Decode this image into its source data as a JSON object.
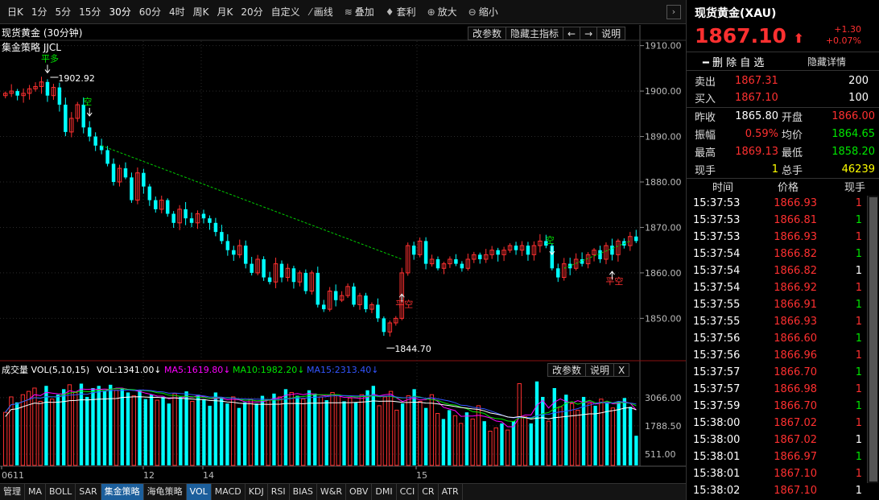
{
  "toolbar": {
    "periods": [
      "日K",
      "1分",
      "5分",
      "15分",
      "30分",
      "60分",
      "4时",
      "周K",
      "月K",
      "20分",
      "自定义"
    ],
    "active_period": "30分",
    "tools": [
      {
        "icon": "draw-line-icon",
        "label": "画线"
      },
      {
        "icon": "overlay-icon",
        "label": "叠加"
      },
      {
        "icon": "arbitrage-icon",
        "label": "套利"
      },
      {
        "icon": "zoom-in-icon",
        "label": "放大"
      },
      {
        "icon": "zoom-out-icon",
        "label": "缩小"
      }
    ],
    "collapse": "›"
  },
  "main": {
    "title": "现货黄金 (30分钟)",
    "strategy": "集金策略 JJCL",
    "buttons": [
      "改参数",
      "隐藏主指标",
      "←",
      "→",
      "说明"
    ]
  },
  "vol": {
    "label": "成交量 VOL(5,10,15)",
    "vol": "VOL:1341.00↓",
    "ma5": "MA5:1619.80↓",
    "ma10": "MA10:1982.20↓",
    "ma15": "MA15:2313.40↓",
    "buttons": [
      "改参数",
      "说明",
      "X"
    ]
  },
  "colors": {
    "up": "#ff3030",
    "down": "#00ffff",
    "ma5": "#ff00ff",
    "ma10": "#00e600",
    "ma15": "#3355ff",
    "vol_ma_white": "#ffffff",
    "trend": "#00cc00"
  },
  "chart_data": {
    "type": "candlestick",
    "ylim": [
      1840.5,
      1911
    ],
    "y_ticks": [
      "1910.00",
      "1900.00",
      "1890.00",
      "1880.00",
      "1870.00",
      "1860.00",
      "1850.00"
    ],
    "x_labels": [
      "0611",
      "12",
      "14",
      "15"
    ],
    "annotations": [
      {
        "text": "平多",
        "kind": "signal"
      },
      {
        "text": "1902.92",
        "kind": "value"
      },
      {
        "text": "空",
        "kind": "signal"
      },
      {
        "text": "平空",
        "kind": "signal"
      },
      {
        "text": "1844.70",
        "kind": "value"
      },
      {
        "text": "空",
        "kind": "signal"
      },
      {
        "text": "平空",
        "kind": "signal"
      }
    ],
    "closes": [
      1899.5,
      1900,
      1899,
      1899.5,
      1900.5,
      1901,
      1902,
      1899,
      1900.8,
      1897,
      1891,
      1894,
      1897,
      1892,
      1890,
      1888,
      1887,
      1884,
      1880,
      1883,
      1881,
      1876,
      1882,
      1879,
      1876,
      1874,
      1876,
      1873,
      1871,
      1874,
      1872,
      1871,
      1873,
      1872,
      1871,
      1869,
      1867,
      1865,
      1864,
      1866,
      1862,
      1860,
      1863,
      1859,
      1858,
      1862,
      1859,
      1861,
      1858,
      1860,
      1856,
      1860,
      1853,
      1852,
      1856,
      1854,
      1855,
      1857,
      1853,
      1855,
      1852,
      1853,
      1850,
      1847,
      1849,
      1850,
      1860,
      1866,
      1864,
      1867,
      1862,
      1863,
      1861,
      1862,
      1863,
      1862,
      1861,
      1863,
      1864,
      1863,
      1864,
      1865,
      1864,
      1865,
      1866,
      1865,
      1866,
      1864,
      1866,
      1867,
      1866,
      1861,
      1859,
      1862,
      1861,
      1863,
      1862,
      1864,
      1865,
      1863,
      1866,
      1864,
      1867,
      1866,
      1868,
      1867
    ],
    "volume": {
      "yticks": [
        "3066.00",
        "1788.50",
        "511.00"
      ],
      "ylim": [
        0,
        3900
      ],
      "values": [
        2400,
        3100,
        2850,
        3200,
        3350,
        3500,
        2900,
        3600,
        3000,
        3200,
        3450,
        3650,
        3300,
        3700,
        3100,
        3500,
        3600,
        3350,
        3650,
        3400,
        3500,
        3300,
        3150,
        3400,
        3000,
        3200,
        2950,
        3100,
        2800,
        3250,
        3100,
        3350,
        2900,
        3200,
        3000,
        2700,
        3300,
        3050,
        2800,
        3100,
        2600,
        2850,
        3000,
        2800,
        3150,
        2950,
        3250,
        3100,
        3450,
        3300,
        3150,
        3000,
        3400,
        3250,
        3100,
        2950,
        3300,
        3150,
        2900,
        3050,
        2850,
        3200,
        3400,
        3600,
        2700,
        3100,
        3350,
        2500,
        2800,
        3150,
        3450,
        2900,
        2600,
        3200,
        2350,
        2100,
        2500,
        2250,
        1900,
        2400,
        2100,
        2700,
        2000,
        1550,
        1700,
        1900,
        1600,
        2000,
        3700,
        2200,
        1900,
        3800,
        3100,
        2000,
        3500,
        2650,
        3200,
        2800,
        2500,
        3100,
        2800,
        2700,
        3000,
        2850,
        2600,
        2900,
        3050,
        2650,
        1341
      ]
    }
  },
  "side": {
    "title": "现货黄金(XAU)",
    "price": "1867.10",
    "change": "+1.30",
    "change_pct": "+0.07%",
    "delete_label": "━ 删 除 自 选",
    "hide_label": "隐藏详情",
    "sell": {
      "label": "卖出",
      "price": "1867.31",
      "qty": "200"
    },
    "buy": {
      "label": "买入",
      "price": "1867.10",
      "qty": "100"
    },
    "stats": [
      [
        {
          "l": "昨收",
          "v": "1865.80",
          "c": "white"
        },
        {
          "l": "开盘",
          "v": "1866.00",
          "c": "red"
        }
      ],
      [
        {
          "l": "振幅",
          "v": "0.59%",
          "c": "red"
        },
        {
          "l": "均价",
          "v": "1864.65",
          "c": "green"
        }
      ],
      [
        {
          "l": "最高",
          "v": "1869.13",
          "c": "red"
        },
        {
          "l": "最低",
          "v": "1858.20",
          "c": "green"
        }
      ],
      [
        {
          "l": "现手",
          "v": "1",
          "c": "yellow"
        },
        {
          "l": "总手",
          "v": "46239",
          "c": "yellow"
        }
      ]
    ],
    "tick_headers": [
      "时间",
      "价格",
      "现手"
    ],
    "ticks": [
      {
        "t": "15:37:53",
        "p": "1866.93",
        "q": "1",
        "c": "red"
      },
      {
        "t": "15:37:53",
        "p": "1866.81",
        "q": "1",
        "c": "green"
      },
      {
        "t": "15:37:53",
        "p": "1866.93",
        "q": "1",
        "c": "red"
      },
      {
        "t": "15:37:54",
        "p": "1866.82",
        "q": "1",
        "c": "green"
      },
      {
        "t": "15:37:54",
        "p": "1866.82",
        "q": "1",
        "c": "white"
      },
      {
        "t": "15:37:54",
        "p": "1866.92",
        "q": "1",
        "c": "red"
      },
      {
        "t": "15:37:55",
        "p": "1866.91",
        "q": "1",
        "c": "green"
      },
      {
        "t": "15:37:55",
        "p": "1866.93",
        "q": "1",
        "c": "red"
      },
      {
        "t": "15:37:56",
        "p": "1866.60",
        "q": "1",
        "c": "green"
      },
      {
        "t": "15:37:56",
        "p": "1866.96",
        "q": "1",
        "c": "red"
      },
      {
        "t": "15:37:57",
        "p": "1866.70",
        "q": "1",
        "c": "green"
      },
      {
        "t": "15:37:57",
        "p": "1866.98",
        "q": "1",
        "c": "red"
      },
      {
        "t": "15:37:59",
        "p": "1866.70",
        "q": "1",
        "c": "green"
      },
      {
        "t": "15:38:00",
        "p": "1867.02",
        "q": "1",
        "c": "red"
      },
      {
        "t": "15:38:00",
        "p": "1867.02",
        "q": "1",
        "c": "white"
      },
      {
        "t": "15:38:01",
        "p": "1866.97",
        "q": "1",
        "c": "green"
      },
      {
        "t": "15:38:01",
        "p": "1867.10",
        "q": "1",
        "c": "red"
      },
      {
        "t": "15:38:02",
        "p": "1867.10",
        "q": "1",
        "c": "white"
      }
    ]
  },
  "bottom_tabs": [
    "管理",
    "MA",
    "BOLL",
    "SAR",
    "集金策略",
    "海龟策略",
    "VOL",
    "MACD",
    "KDJ",
    "RSI",
    "BIAS",
    "W&R",
    "OBV",
    "DMI",
    "CCI",
    "CR",
    "ATR"
  ],
  "bottom_active": [
    "集金策略",
    "VOL"
  ]
}
